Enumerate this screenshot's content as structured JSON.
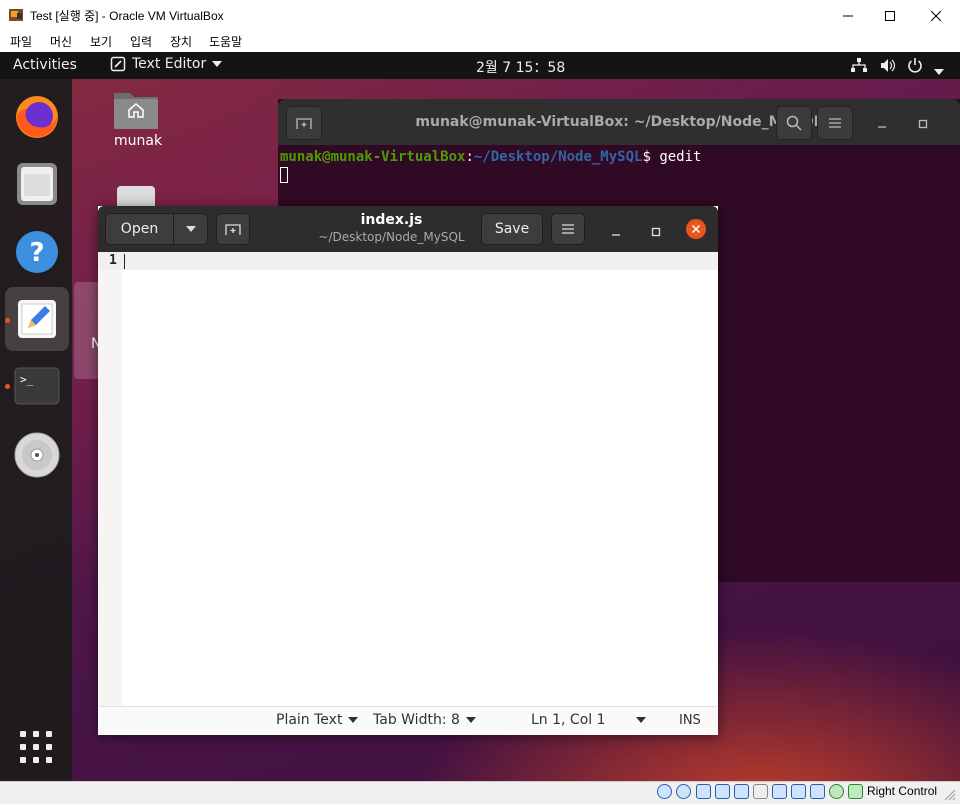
{
  "host": {
    "window_title": "Test [실행 중] - Oracle VM VirtualBox",
    "menu": [
      "파일",
      "머신",
      "보기",
      "입력",
      "장치",
      "도움말"
    ],
    "status_right_control": "Right Control"
  },
  "guest_topbar": {
    "activities": "Activities",
    "app_menu": "Text Editor",
    "clock": "2월 7  15：58"
  },
  "desktop": {
    "home_label": "munak",
    "partial_label": "N"
  },
  "terminal": {
    "title": "munak@munak-VirtualBox: ~/Desktop/Node_MySQL",
    "prompt_user": "munak@munak-VirtualBox",
    "prompt_sep": ":",
    "prompt_path": "~/Desktop/Node_MySQL",
    "prompt_dollar": "$",
    "command": " gedit"
  },
  "gedit": {
    "open_label": "Open",
    "filename": "index.js",
    "path": "~/Desktop/Node_MySQL",
    "save_label": "Save",
    "line_number": "1",
    "status": {
      "language": "Plain Text",
      "tab_width": "Tab Width: 8",
      "position": "Ln 1, Col 1",
      "mode": "INS"
    }
  },
  "colors": {
    "ubuntu_orange": "#e95420",
    "terminal_bg": "#300a24",
    "prompt_green": "#4e9a06",
    "prompt_blue": "#3465a4"
  }
}
